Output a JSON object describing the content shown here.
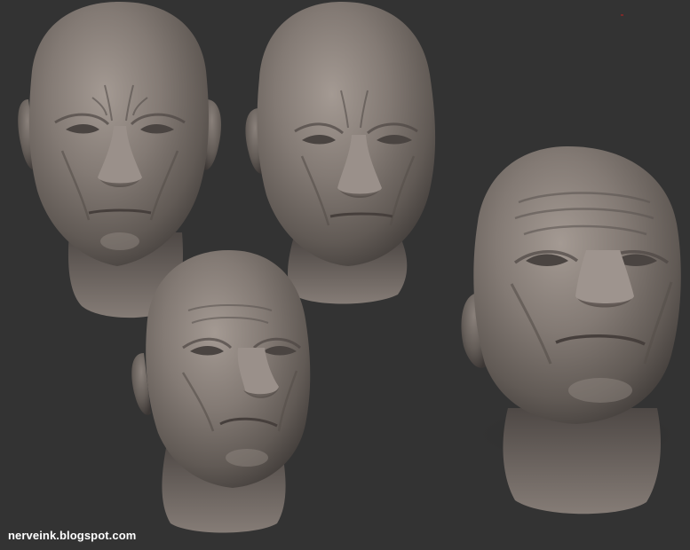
{
  "scene": {
    "background": "#333333",
    "clay_color": "#7a726d",
    "subjects": [
      "sculpted-head-front",
      "sculpted-head-three-quarter",
      "sculpted-head-low-angle",
      "sculpted-head-large-upward"
    ]
  },
  "watermark": {
    "text": "nerveink.blogspot.com",
    "color": "#ffffff"
  }
}
